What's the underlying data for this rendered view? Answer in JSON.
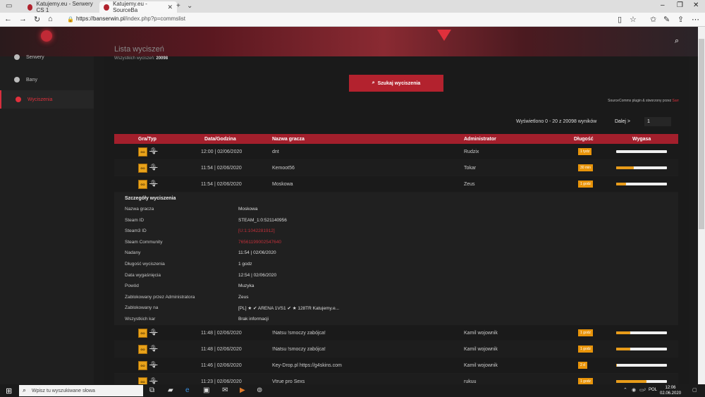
{
  "browser": {
    "tabs": [
      {
        "label": "Katujemy.eu - Serwery CS 1",
        "active": false
      },
      {
        "label": "Katujemy.eu - SourceBa",
        "active": true
      }
    ],
    "url_host": "https://banserwin.pl",
    "url_path": "/index.php?p=commslist"
  },
  "sidebar": {
    "items": [
      {
        "label": "Serwery"
      },
      {
        "label": "Bany"
      },
      {
        "label": "Wyciszenia",
        "active": true
      }
    ]
  },
  "content": {
    "title": "Lista wyciszeń",
    "subtitle_prefix": "Wszystkich wyciszeń:",
    "subtitle_count": "20098",
    "search_button": "Szukaj wyciszenia",
    "plugin_text": "SourceComms plugin & stworzony przez",
    "plugin_author": "Sarr",
    "shown_text": "Wyświetlono 0 - 20 z 20098 wyników",
    "goto_label": "Dalej >",
    "page_value": "1"
  },
  "table": {
    "headers": {
      "game": "Gra/Typ",
      "date": "Data/Godzina",
      "player": "Nazwa gracza",
      "admin": "Administrator",
      "length": "Długość",
      "expires": "Wygasa"
    },
    "rows_top": [
      {
        "date": "12:00 | 02/06/2020",
        "player": "dnt",
        "admin": "Rudzix",
        "length": "1 tydz",
        "progress": 0.0
      },
      {
        "date": "11:54 | 02/06/2020",
        "player": "Kemoot56",
        "admin": "Tokar",
        "length": "30 min",
        "progress": 0.35
      },
      {
        "date": "11:54 | 02/06/2020",
        "player": "Moskowa",
        "admin": "Zeus",
        "length": "1 godz",
        "progress": 0.2
      }
    ],
    "details": {
      "heading": "Szczegóły wyciszenia",
      "rows": [
        {
          "k": "Nazwa gracza",
          "v": "Moskowa"
        },
        {
          "k": "Steam ID",
          "v": "STEAM_1:0:521140956"
        },
        {
          "k": "Steam3 ID",
          "v": "[U:1:1042281912]",
          "red": true
        },
        {
          "k": "Steam Community",
          "v": "76561199002547640",
          "red": true
        },
        {
          "k": "Nadany",
          "v": "11:54 | 02/06/2020"
        },
        {
          "k": "Długość wyciszenia",
          "v": "1 godz"
        },
        {
          "k": "Data wygaśnięcia",
          "v": "12:54 | 02/06/2020"
        },
        {
          "k": "Powód",
          "v": "Muzyka"
        },
        {
          "k": "Zablokowany przez Administratora",
          "v": "Zeus"
        },
        {
          "k": "Zablokowany na",
          "v": "[PL] ★ ✔ ARENA 1VS1 ✔ ★ 128TR Katujemy.e..."
        },
        {
          "k": "Wszystkich kar",
          "v": "Brak informacji"
        }
      ]
    },
    "rows_bottom": [
      {
        "date": "11:48 | 02/06/2020",
        "player": "!Natsu !smoczy zabójca!",
        "admin": "Kamil wojownik",
        "length": "1 godz",
        "progress": 0.28
      },
      {
        "date": "11:48 | 02/06/2020",
        "player": "!Natsu !smoczy zabójca!",
        "admin": "Kamil wojownik",
        "length": "1 godz",
        "progress": 0.28
      },
      {
        "date": "11:46 | 02/06/2020",
        "player": "Key-Drop.pl https://g4skins.com",
        "admin": "Kamil wojownik",
        "length": "2 d",
        "progress": 0.02
      },
      {
        "date": "11:23 | 02/06/2020",
        "player": "Vtrue pro Sexs",
        "admin": "rukuu",
        "length": "1 godz",
        "progress": 0.6
      }
    ]
  },
  "taskbar": {
    "search_placeholder": "Wpisz tu wyszukiwane słowa",
    "lang": "POL",
    "time": "12:06",
    "date": "02.06.2020"
  },
  "colors": {
    "accent": "#b3222e",
    "duration_badge": "#e8940a",
    "progress_fill": "#e89c1a"
  }
}
